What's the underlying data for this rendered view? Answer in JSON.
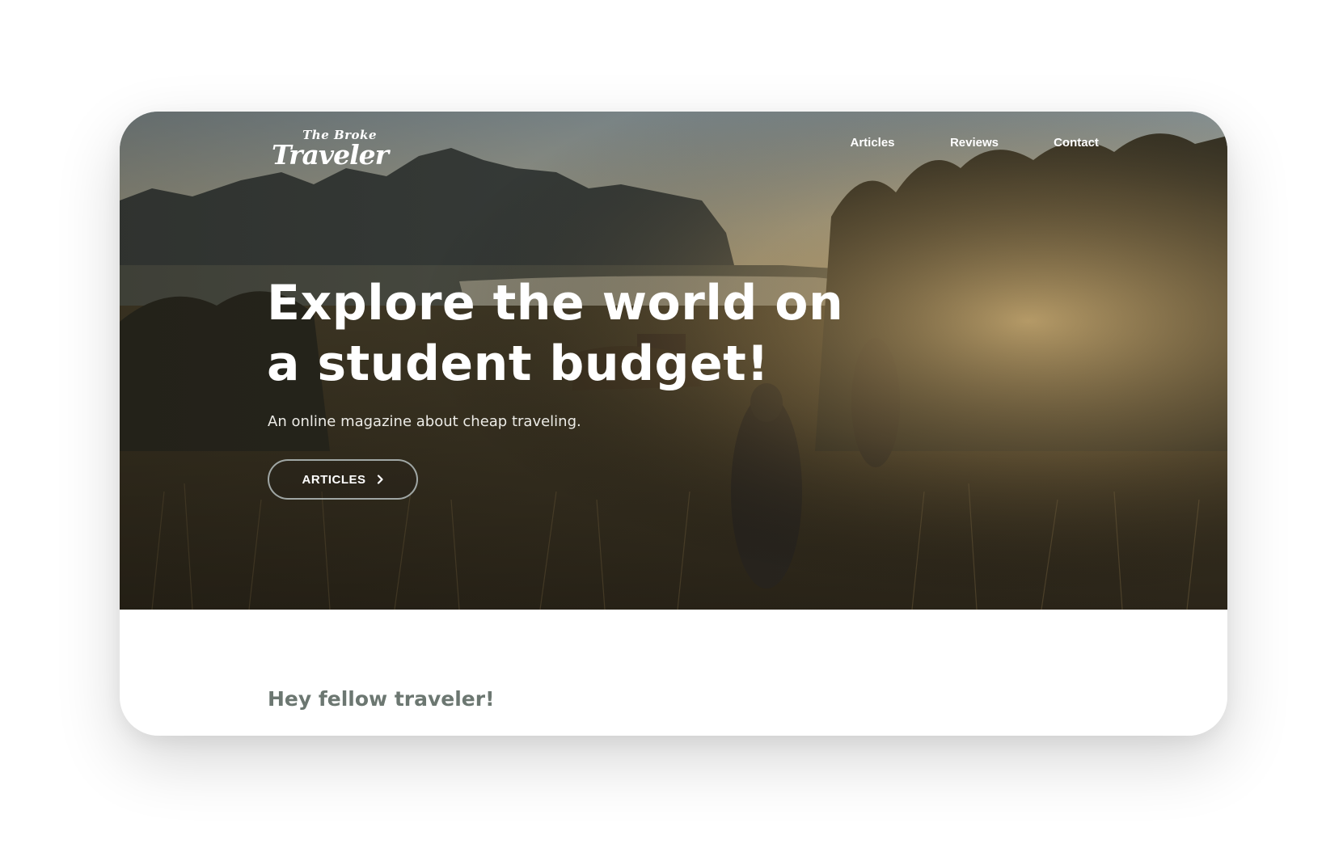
{
  "brand": {
    "logo_small": "The Broke",
    "logo_big": "Traveler"
  },
  "nav": {
    "items": [
      {
        "label": "Articles"
      },
      {
        "label": "Reviews"
      },
      {
        "label": "Contact"
      }
    ]
  },
  "hero": {
    "headline": "Explore the world on a student budget!",
    "subtitle": "An online magazine about cheap traveling.",
    "cta_label": "ARTICLES",
    "cta_icon": "chevron-right-icon",
    "image": "hikers-walking-through-tall-grass-toward-mountain-fjord-at-sunset"
  },
  "intro": {
    "heading": "Hey fellow traveler!"
  },
  "colors": {
    "heading_muted": "#6c7771",
    "text_white": "#ffffff",
    "cta_border": "#bec8c8"
  }
}
